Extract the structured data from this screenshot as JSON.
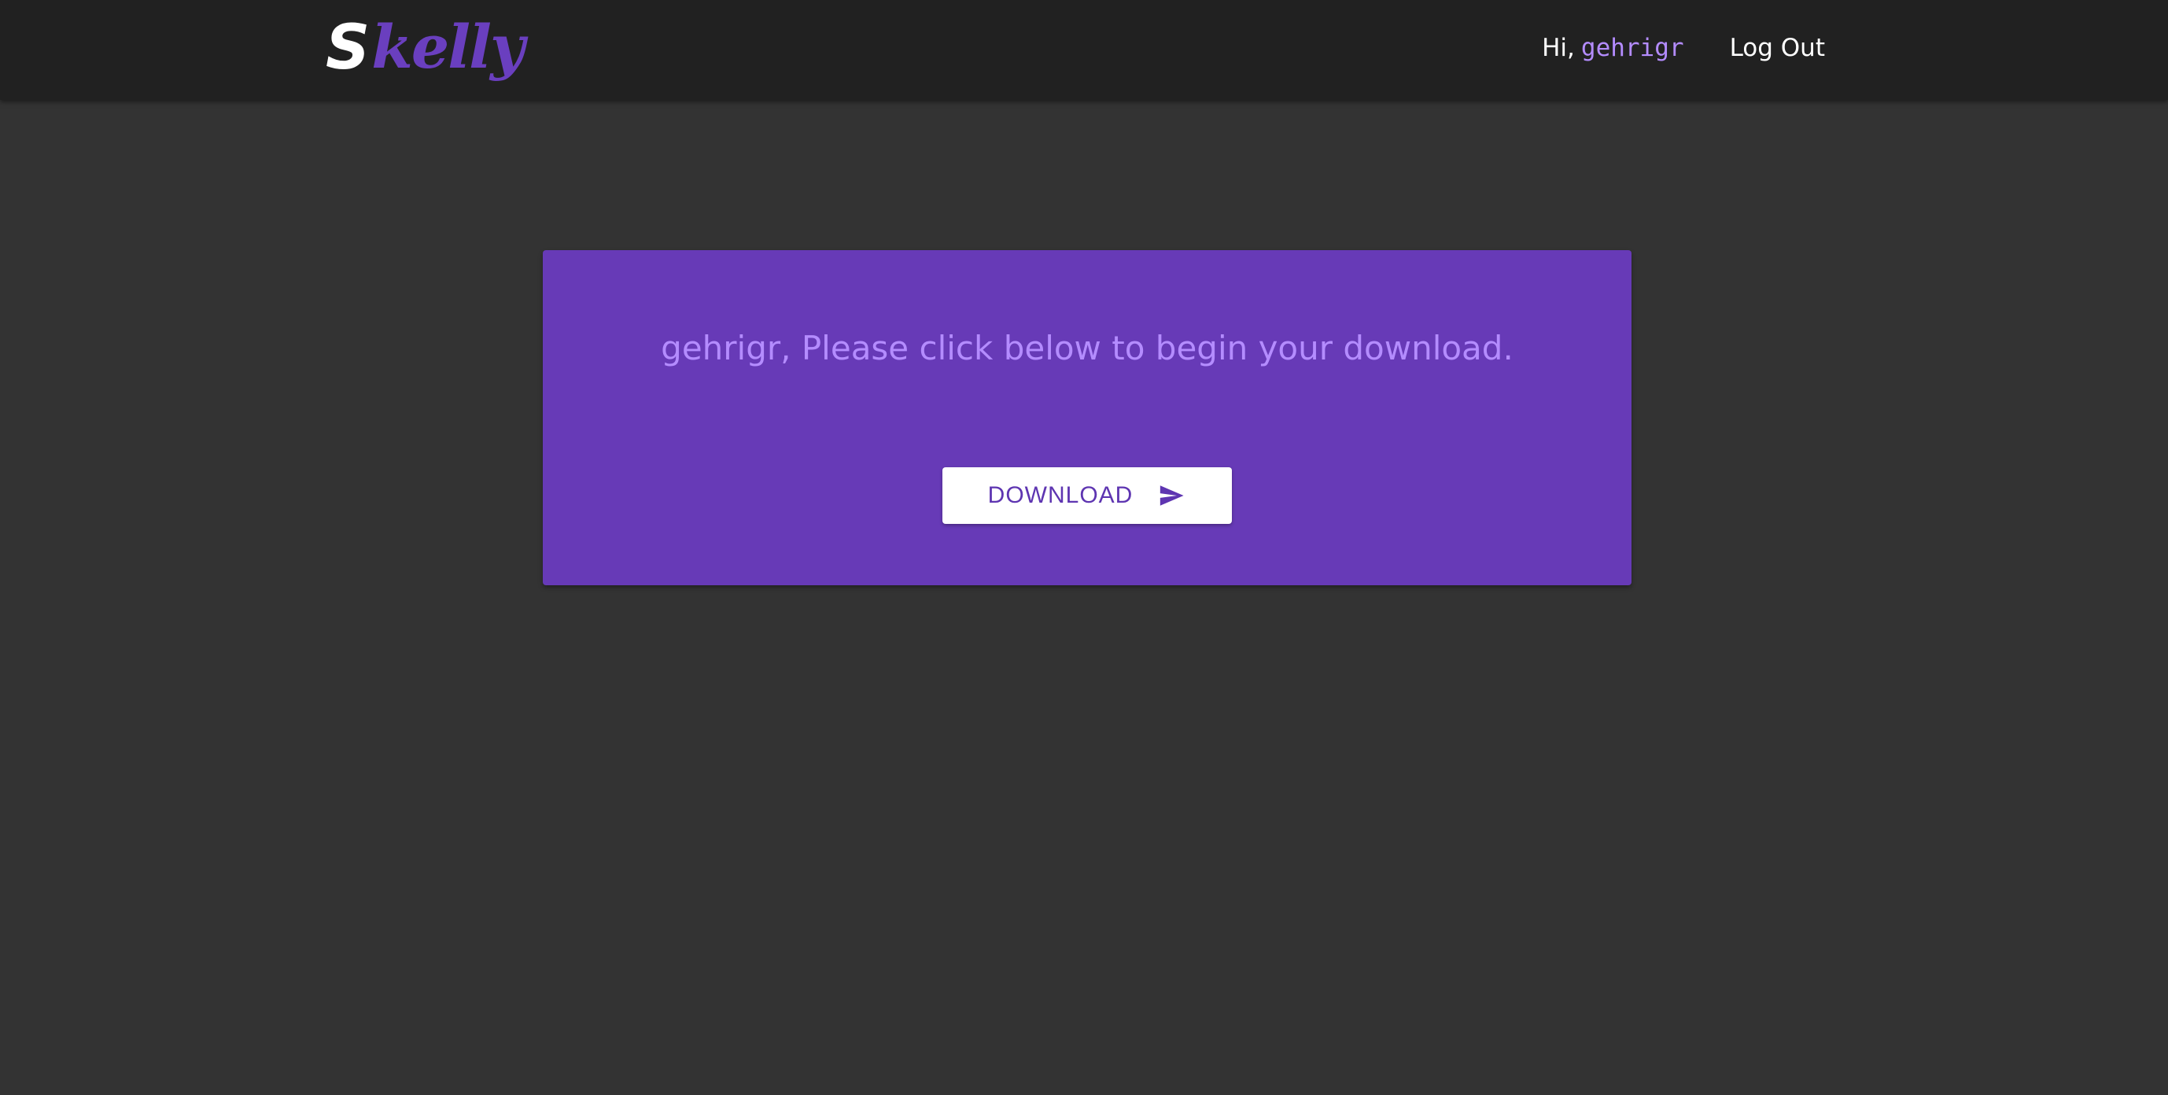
{
  "header": {
    "logo_first": "S",
    "logo_rest": "kelly",
    "greeting": "Hi,",
    "username": "gehrigr",
    "logout_label": "Log Out"
  },
  "card": {
    "message": "gehrigr, Please click below to begin your download.",
    "download_label": "DOWNLOAD",
    "download_icon": "send-icon"
  },
  "colors": {
    "page_background": "#333333",
    "navbar_background": "#212121",
    "card_background": "#673ab7",
    "accent_light": "#b48cff",
    "button_text": "#5e35b1"
  }
}
